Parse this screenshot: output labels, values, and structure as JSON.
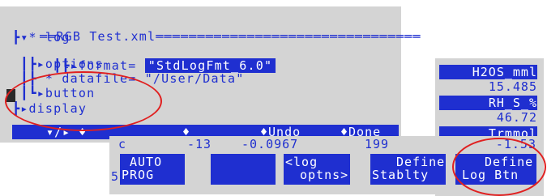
{
  "editor": {
    "title_prefix": "══",
    "title": "RGB Test.xml",
    "title_suffix": "════════════════════════════════",
    "tree": {
      "log_line": "┣▾* log",
      "format_prefix": " ┃┣▸format= ",
      "format_value": "\"StdLogFmt_6.0\"",
      "options_line": " ┃┣▸options",
      "datafile_line": " ┃┣ * datafile= \"/User/Data\"",
      "button_line": " ┃┗▸button",
      "display_line": "┣▸display"
    },
    "statusbar": {
      "arrows": "▾/▸  ♦",
      "diamond": "♦",
      "undo": "♦Undo",
      "done": "♦Done"
    }
  },
  "vars": [
    {
      "label": "H2OS_mml",
      "value": "15.485"
    },
    {
      "label": "RH_S_%",
      "value": "46.72"
    },
    {
      "label": "Trmmol",
      "value": "-1.53"
    }
  ],
  "fkeys": {
    "row_prefix": "c",
    "row_values": [
      "-13",
      "-0.0967",
      "199"
    ],
    "row_number": "5",
    "keys": [
      {
        "line1": "AUTO",
        "line2": "PROG"
      },
      {
        "line1": "",
        "line2": ""
      },
      {
        "line1": "<log",
        "line2": "optns>"
      },
      {
        "line1": "Define",
        "line2": "Stablty"
      },
      {
        "line1": "Define",
        "line2": "Log Btn"
      }
    ]
  },
  "colors": {
    "accent": "#1f2fd0",
    "panel": "#d4d4d4",
    "annotation": "#e02020"
  }
}
